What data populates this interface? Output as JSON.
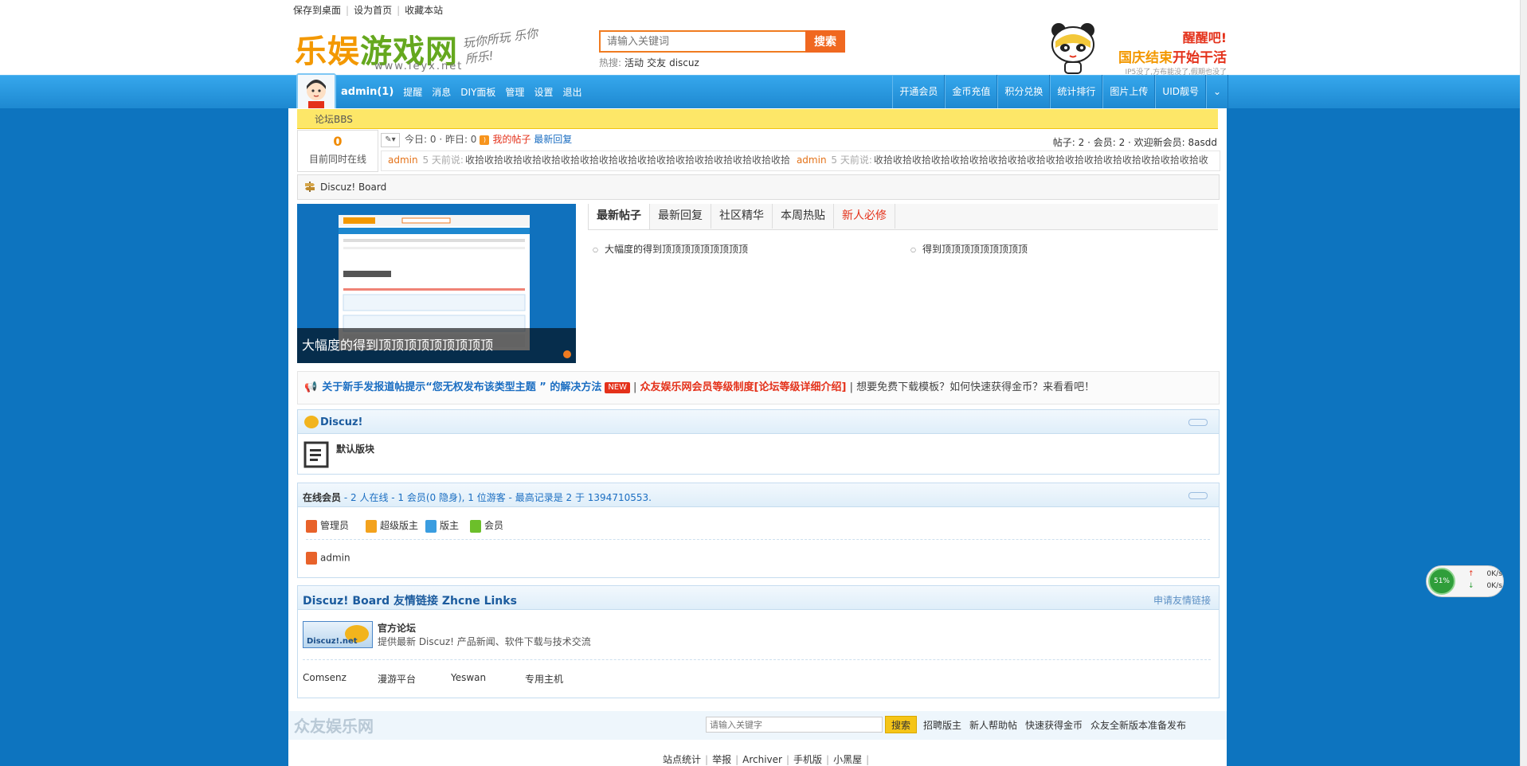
{
  "topbar": {
    "links": [
      "保存到桌面",
      "设为首页",
      "收藏本站"
    ]
  },
  "logo": {
    "text_a": "乐娱",
    "text_b": "游戏网",
    "url": "www.leyx.net",
    "slogan": "玩你所玩 乐你所乐!"
  },
  "search": {
    "placeholder": "请输入关键词",
    "button": "搜索",
    "hot_label": "热搜:",
    "hot_words": [
      "活动",
      "交友",
      "discuz"
    ]
  },
  "ad": {
    "line1": "醒醒吧!",
    "line2a": "国庆结束",
    "line2b": "开始干活",
    "line3": "IP5没了,方布能没了,假期也没了"
  },
  "nav": {
    "user": "admin(1)",
    "left_items": [
      "提醒",
      "消息",
      "DIY面板",
      "管理",
      "设置",
      "退出"
    ],
    "right_items": [
      "开通会员",
      "金币充值",
      "积分兑换",
      "统计排行",
      "图片上传",
      "UID靓号"
    ],
    "dropdown": "⌄"
  },
  "breadcrumb": "论坛BBS",
  "stats": {
    "online_count": "0",
    "online_label": "目前同时在线",
    "today": "今日: 0",
    "yesterday": "昨日: 0",
    "my_posts": "我的帖子",
    "latest_reply": "最新回复",
    "summary": "帖子: 2 · 会员: 2 · 欢迎新会员: 8asdd"
  },
  "ticker": [
    {
      "name": "admin",
      "time": "5 天前说:",
      "text": "收拾收拾收拾收拾收拾收拾收拾收拾收拾收拾收拾收拾收拾收拾收拾收拾收拾"
    },
    {
      "name": "admin",
      "time": "5 天前说:",
      "text": "收拾收拾收拾收拾收拾收拾收拾收拾收拾收拾收拾收拾收拾收拾收拾收拾收拾收"
    }
  ],
  "board": {
    "title": "Discuz! Board"
  },
  "slide": {
    "caption": "大幅度的得到顶顶顶顶顶顶顶顶顶"
  },
  "tabs": [
    {
      "label": "最新帖子",
      "active": true,
      "red": false
    },
    {
      "label": "最新回复",
      "active": false,
      "red": false
    },
    {
      "label": "社区精华",
      "active": false,
      "red": false
    },
    {
      "label": "本周热贴",
      "active": false,
      "red": false
    },
    {
      "label": "新人必修",
      "active": false,
      "red": true
    }
  ],
  "posts": [
    "大幅度的得到顶顶顶顶顶顶顶顶顶",
    "得到顶顶顶顶顶顶顶顶顶"
  ],
  "announce": {
    "part1": "关于新手发报道帖提示“您无权发布该类型主题 ” 的解决方法",
    "badge": "NEW",
    "part2": "众友娱乐网会员等级制度[论坛等级详细介绍]",
    "part3": "想要免费下载模板？如何快速获得金币？来看看吧！"
  },
  "forum": {
    "title": "Discuz!",
    "board_name": "默认版块"
  },
  "online": {
    "label": "在线会员",
    "detail": "- 2 人在线 - 1 会员(0 隐身), 1 位游客 - 最高记录是 2 于 1394710553.",
    "legend": [
      "管理员",
      "超级版主",
      "版主",
      "会员"
    ],
    "legend_colors": [
      "#e8622a",
      "#f3a21d",
      "#3a9de0",
      "#6cbf2a"
    ],
    "users": [
      "admin"
    ]
  },
  "links": {
    "title": "Discuz! Board 友情链接 Zhcne Links",
    "apply": "申请友情链接",
    "logo_text": "Discuz!.net",
    "official_name": "官方论坛",
    "official_desc": "提供最新 Discuz! 产品新闻、软件下载与技术交流",
    "text_links": [
      "Comsenz",
      "漫游平台",
      "Yeswan",
      "专用主机"
    ]
  },
  "footer": {
    "logo": "众友娱乐网",
    "search_placeholder": "请输入关键字",
    "search_button": "搜索",
    "links": [
      "招聘版主",
      "新人帮助帖",
      "快速获得金币",
      "众友全新版本准备发布"
    ],
    "bottom_links": [
      "站点统计",
      "举报",
      "Archiver",
      "手机版",
      "小黑屋"
    ]
  },
  "speed_widget": {
    "percent": "51%",
    "up": "0K/s",
    "down": "0K/s"
  }
}
